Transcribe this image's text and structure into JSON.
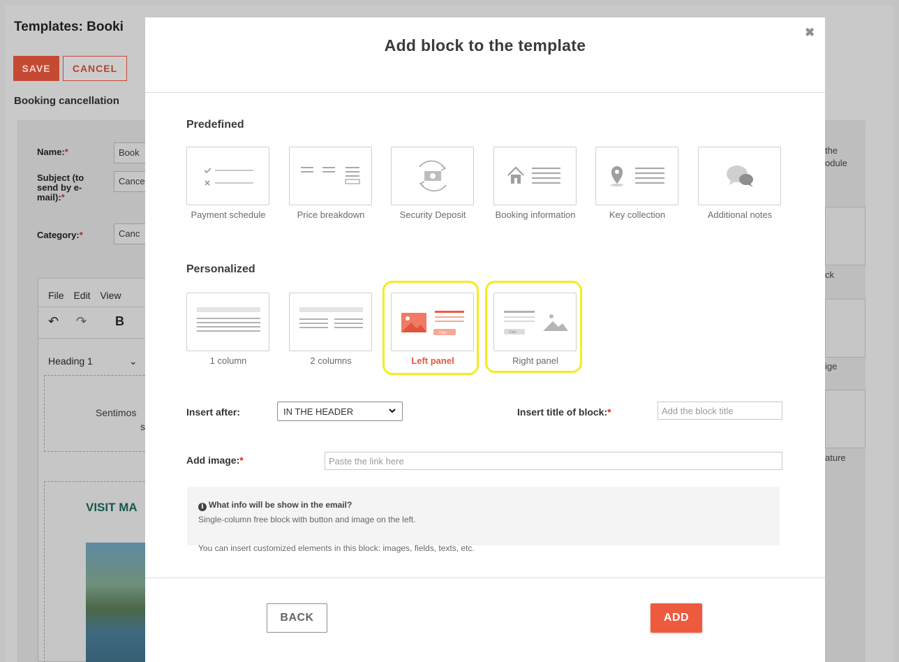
{
  "background": {
    "title": "Templates: Booki",
    "save_label": "SAVE",
    "cancel_label": "CANCEL",
    "subtitle": "Booking cancellation",
    "name_label": "Name:",
    "name_value": "Book",
    "subject_label": "Subject (to send by e-mail):",
    "subject_value": "Cance",
    "category_label": "Category:",
    "category_value": "Canc",
    "menu": "File Edit View",
    "bold_btn": "B",
    "heading_value": "Heading 1",
    "body_text_1": "Sentimos",
    "body_text_2": "s",
    "visit_text": "VISIT MA",
    "side_text_1": "the",
    "side_text_2": "odule",
    "side_text_3": "ck",
    "side_text_4": "ige",
    "side_text_5": "ature"
  },
  "modal": {
    "title": "Add block to the template",
    "close_icon": "close-icon",
    "predefined": {
      "title": "Predefined",
      "items": [
        {
          "label": "Payment schedule",
          "icon": "payment-schedule-icon"
        },
        {
          "label": "Price breakdown",
          "icon": "price-breakdown-icon"
        },
        {
          "label": "Security Deposit",
          "icon": "security-deposit-icon"
        },
        {
          "label": "Booking information",
          "icon": "booking-information-icon"
        },
        {
          "label": "Key collection",
          "icon": "key-collection-icon"
        },
        {
          "label": "Additional notes",
          "icon": "additional-notes-icon"
        }
      ]
    },
    "personalized": {
      "title": "Personalized",
      "items": [
        {
          "label": "1 column",
          "icon": "one-column-icon"
        },
        {
          "label": "2 columns",
          "icon": "two-columns-icon"
        },
        {
          "label": "Left panel",
          "icon": "left-panel-icon",
          "selected": true
        },
        {
          "label": "Right panel",
          "icon": "right-panel-icon"
        }
      ],
      "card_button_text": "Click"
    },
    "insert_after": {
      "label": "Insert after:",
      "value": "IN THE HEADER"
    },
    "block_title": {
      "label": "Insert title of block:",
      "placeholder": "Add the block title"
    },
    "add_image": {
      "label": "Add image:",
      "placeholder": "Paste the link here"
    },
    "info": {
      "heading": "What info will be show in the email?",
      "line1": "Single-column free block with button and image on the left.",
      "line2": "You can insert customized elements in this block: images, fields, texts, etc."
    },
    "back_label": "BACK",
    "add_label": "ADD",
    "colors": {
      "accent": "#ee5a3d",
      "highlight": "#f4ec1d",
      "text": "#3b3b3b"
    }
  }
}
